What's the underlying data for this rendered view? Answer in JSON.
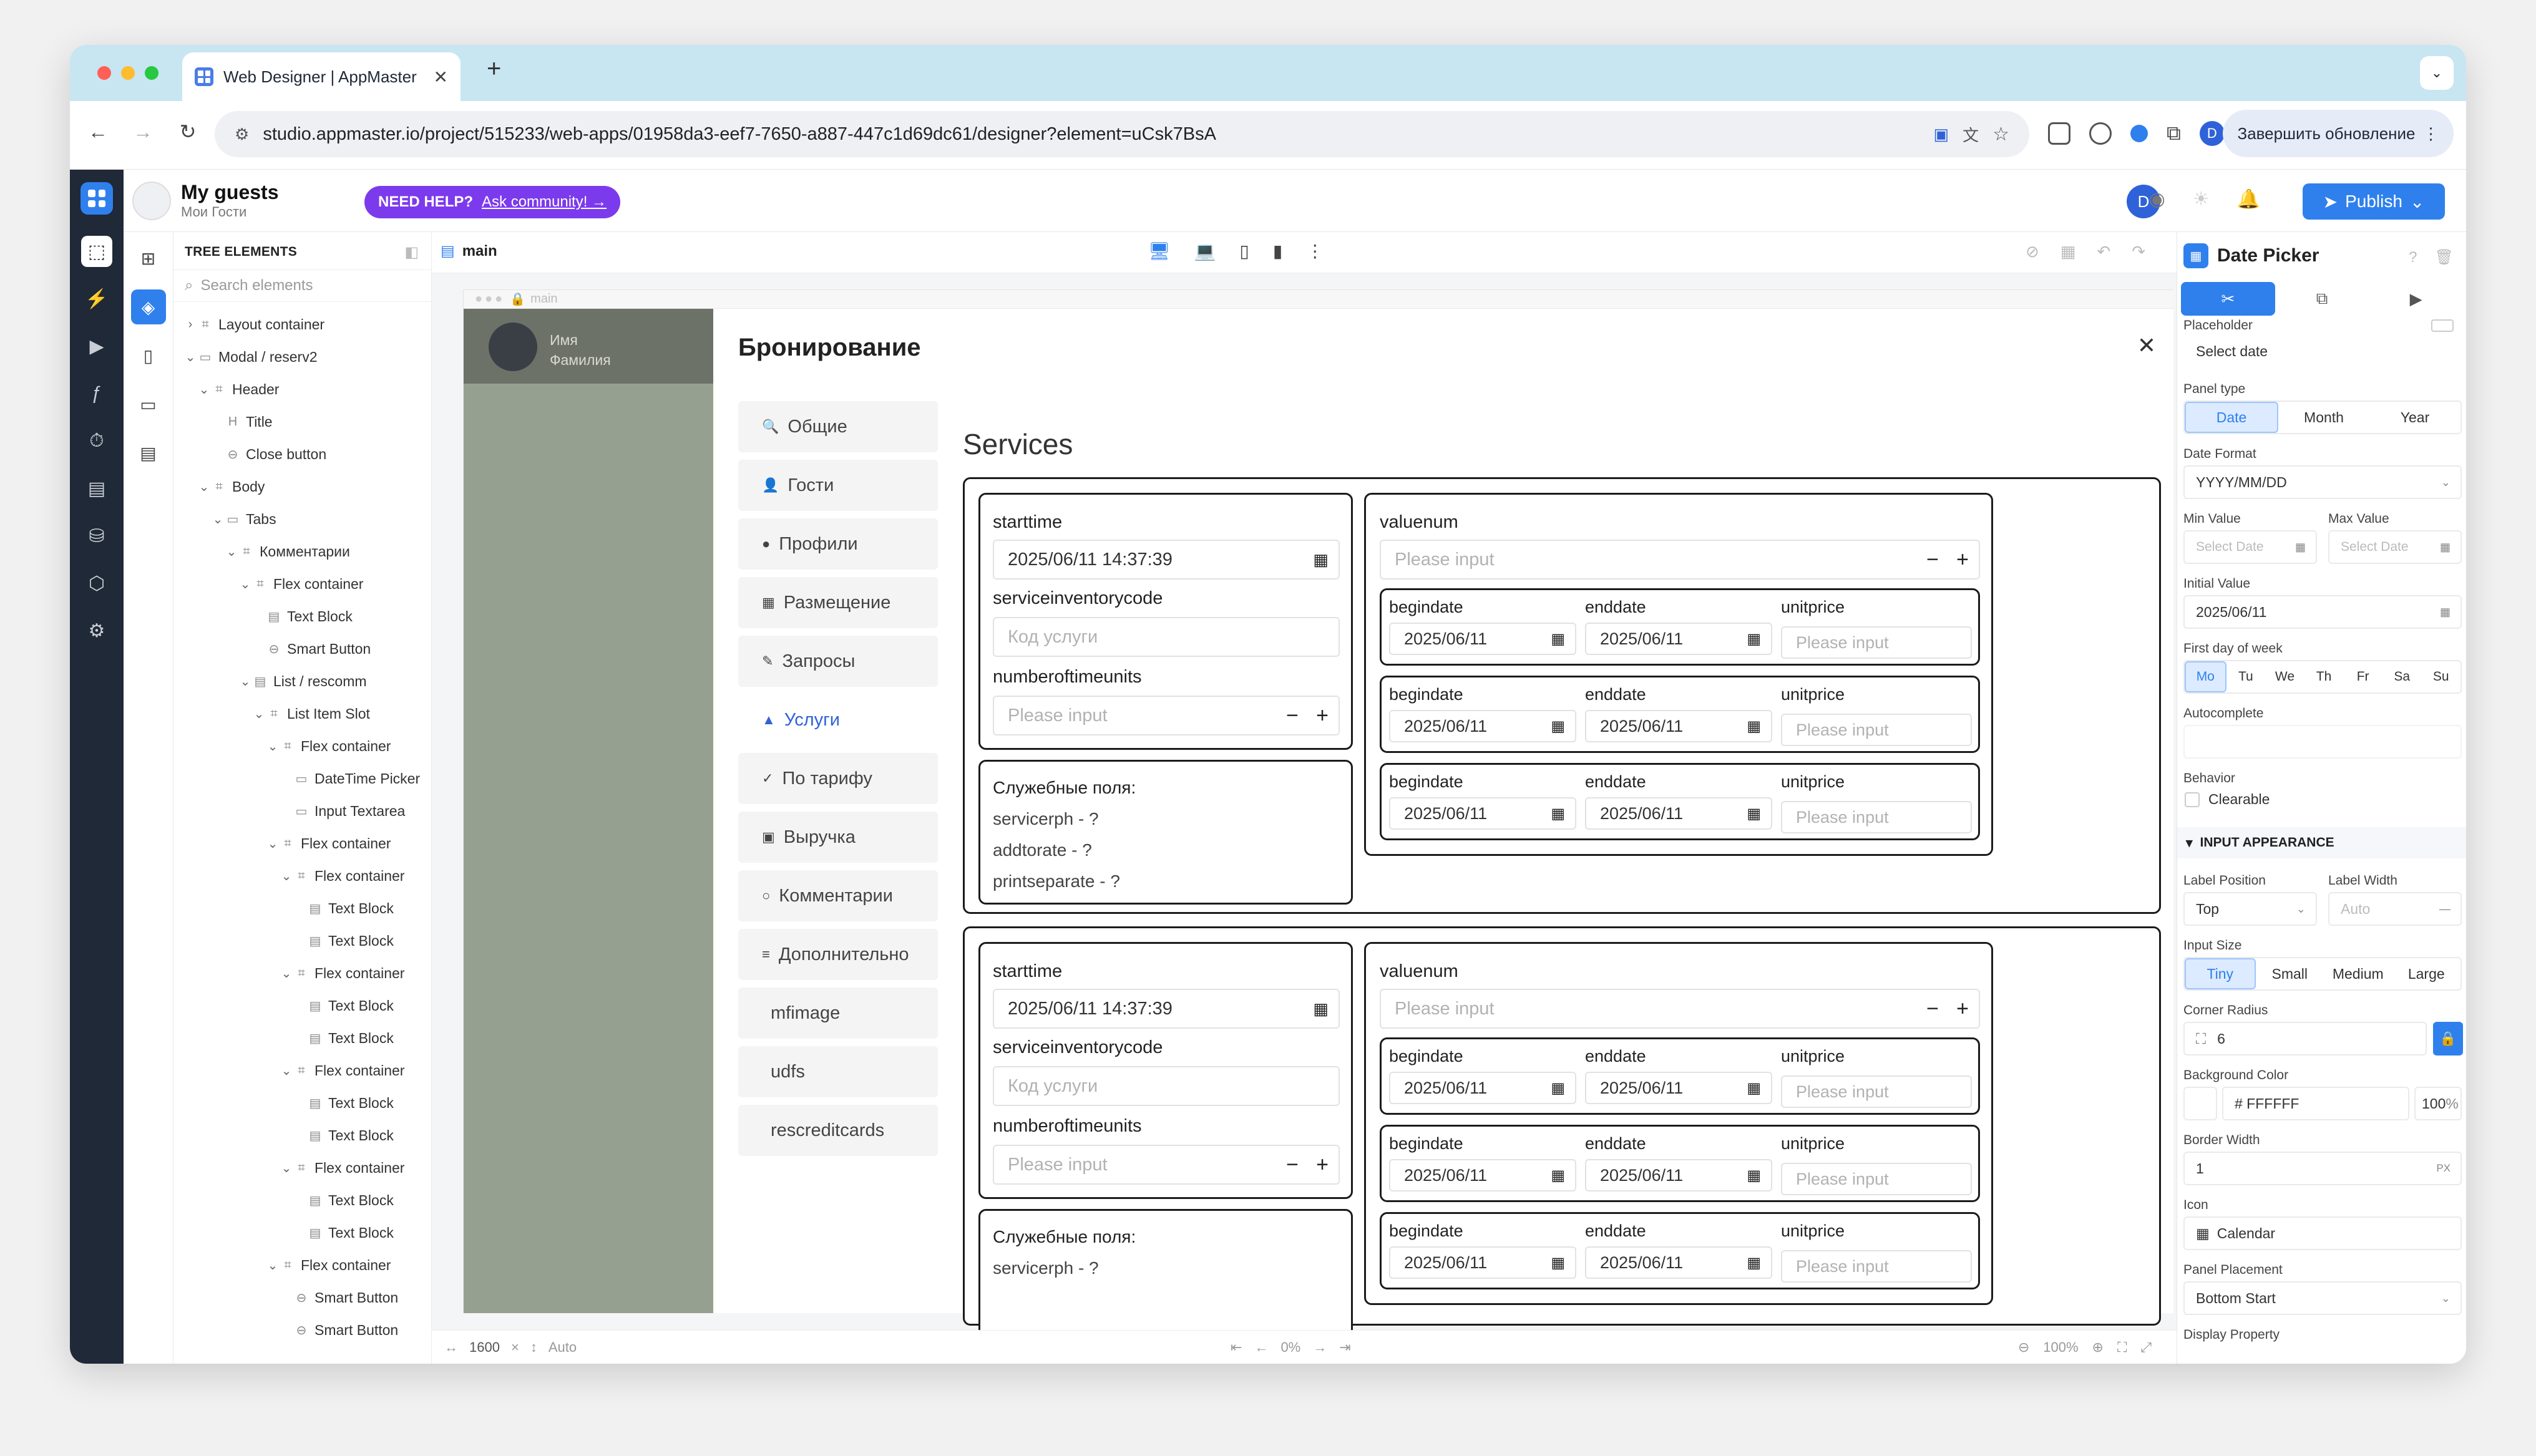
{
  "browser": {
    "tab_title": "Web Designer | AppMaster",
    "url": "studio.appmaster.io/project/515233/web-apps/01958da3-eef7-7650-a887-447c1d69dc61/designer?element=uCsk7BsA",
    "profile_initial": "D",
    "update_button": "Завершить обновление"
  },
  "project": {
    "name": "My guests",
    "subtitle": "Мои Гости",
    "help_label": "NEED HELP?",
    "help_link": "Ask community! →",
    "user_initial": "D",
    "publish": "Publish"
  },
  "tree": {
    "title": "TREE ELEMENTS",
    "search_placeholder": "Search elements",
    "page_name": "main",
    "items": [
      {
        "label": "Layout container",
        "depth": 0,
        "chev": "›",
        "icon": "⌗"
      },
      {
        "label": "Modal / reserv2",
        "depth": 0,
        "chev": "⌄",
        "icon": "▭"
      },
      {
        "label": "Header",
        "depth": 1,
        "chev": "⌄",
        "icon": "⌗"
      },
      {
        "label": "Title",
        "depth": 2,
        "chev": "",
        "icon": "H"
      },
      {
        "label": "Close button",
        "depth": 2,
        "chev": "",
        "icon": "⊖"
      },
      {
        "label": "Body",
        "depth": 1,
        "chev": "⌄",
        "icon": "⌗"
      },
      {
        "label": "Tabs",
        "depth": 2,
        "chev": "⌄",
        "icon": "▭"
      },
      {
        "label": "Комментарии",
        "depth": 3,
        "chev": "⌄",
        "icon": "⌗"
      },
      {
        "label": "Flex container",
        "depth": 4,
        "chev": "⌄",
        "icon": "⌗"
      },
      {
        "label": "Text Block",
        "depth": 5,
        "chev": "",
        "icon": "▤"
      },
      {
        "label": "Smart Button",
        "depth": 5,
        "chev": "",
        "icon": "⊖"
      },
      {
        "label": "List / rescomm",
        "depth": 4,
        "chev": "⌄",
        "icon": "▤"
      },
      {
        "label": "List Item Slot",
        "depth": 5,
        "chev": "⌄",
        "icon": "⌗"
      },
      {
        "label": "Flex container",
        "depth": 6,
        "chev": "⌄",
        "icon": "⌗"
      },
      {
        "label": "DateTime Picker",
        "depth": 7,
        "chev": "",
        "icon": "▭"
      },
      {
        "label": "Input Textarea",
        "depth": 7,
        "chev": "",
        "icon": "▭"
      },
      {
        "label": "Flex container",
        "depth": 6,
        "chev": "⌄",
        "icon": "⌗"
      },
      {
        "label": "Flex container",
        "depth": 7,
        "chev": "⌄",
        "icon": "⌗"
      },
      {
        "label": "Text Block",
        "depth": 8,
        "chev": "",
        "icon": "▤"
      },
      {
        "label": "Text Block",
        "depth": 8,
        "chev": "",
        "icon": "▤"
      },
      {
        "label": "Flex container",
        "depth": 7,
        "chev": "⌄",
        "icon": "⌗"
      },
      {
        "label": "Text Block",
        "depth": 8,
        "chev": "",
        "icon": "▤"
      },
      {
        "label": "Text Block",
        "depth": 8,
        "chev": "",
        "icon": "▤"
      },
      {
        "label": "Flex container",
        "depth": 7,
        "chev": "⌄",
        "icon": "⌗"
      },
      {
        "label": "Text Block",
        "depth": 8,
        "chev": "",
        "icon": "▤"
      },
      {
        "label": "Text Block",
        "depth": 8,
        "chev": "",
        "icon": "▤"
      },
      {
        "label": "Flex container",
        "depth": 7,
        "chev": "⌄",
        "icon": "⌗"
      },
      {
        "label": "Text Block",
        "depth": 8,
        "chev": "",
        "icon": "▤"
      },
      {
        "label": "Text Block",
        "depth": 8,
        "chev": "",
        "icon": "▤"
      },
      {
        "label": "Flex container",
        "depth": 6,
        "chev": "⌄",
        "icon": "⌗"
      },
      {
        "label": "Smart Button",
        "depth": 7,
        "chev": "",
        "icon": "⊖"
      },
      {
        "label": "Smart Button",
        "depth": 7,
        "chev": "",
        "icon": "⊖"
      }
    ]
  },
  "canvas": {
    "frame_label": "main",
    "user_name": "Имя",
    "user_surname": "Фамилия",
    "modal_title": "Бронирование",
    "tabs": [
      {
        "label": "Общие",
        "icon": "🔍",
        "active": false
      },
      {
        "label": "Гости",
        "icon": "👤",
        "active": false
      },
      {
        "label": "Профили",
        "icon": "●",
        "active": false
      },
      {
        "label": "Размещение",
        "icon": "▦",
        "active": false
      },
      {
        "label": "Запросы",
        "icon": "✎",
        "active": false
      },
      {
        "label": "Услуги",
        "icon": "▲",
        "active": true
      },
      {
        "label": "По тарифу",
        "icon": "✓",
        "active": false
      },
      {
        "label": "Выручка",
        "icon": "▣",
        "active": false
      },
      {
        "label": "Комментарии",
        "icon": "○",
        "active": false
      },
      {
        "label": "Дополнительно",
        "icon": "≡",
        "active": false
      },
      {
        "label": "mfimage",
        "icon": "",
        "active": false
      },
      {
        "label": "udfs",
        "icon": "",
        "active": false
      },
      {
        "label": "rescreditcards",
        "icon": "",
        "active": false
      }
    ],
    "services_title": "Services",
    "starttime_label": "starttime",
    "starttime_value": "2025/06/11 14:37:39",
    "serviceinventorycode_label": "serviceinventorycode",
    "serviceinventorycode_placeholder": "Код услуги",
    "numberoftimeunits_label": "numberoftimeunits",
    "please_input": "Please input",
    "system_fields_title": "Служебные поля:",
    "system_fields": [
      "servicerph - ?",
      "addtorate - ?",
      "printseparate - ?"
    ],
    "valuenum_label": "valuenum",
    "begindate_label": "begindate",
    "enddate_label": "enddate",
    "unitprice_label": "unitprice",
    "date_value": "2025/06/11",
    "selected_tag": "Date Picker",
    "footer": {
      "width": "1600",
      "height": "Auto",
      "scroll": "0%",
      "zoom": "100%"
    }
  },
  "props": {
    "title": "Date Picker",
    "placeholder_label": "Placeholder",
    "placeholder_value": "Select date",
    "panel_type_label": "Panel type",
    "panel_types": [
      "Date",
      "Month",
      "Year"
    ],
    "date_format_label": "Date Format",
    "date_format_value": "YYYY/MM/DD",
    "min_value_label": "Min Value",
    "max_value_label": "Max Value",
    "min_placeholder": "Select Date",
    "max_placeholder": "Select Date",
    "initial_value_label": "Initial Value",
    "initial_value": "2025/06/11",
    "first_day_label": "First day of week",
    "weekdays": [
      "Mo",
      "Tu",
      "We",
      "Th",
      "Fr",
      "Sa",
      "Su"
    ],
    "autocomplete_label": "Autocomplete",
    "behavior_label": "Behavior",
    "clearable_label": "Clearable",
    "input_appearance": "INPUT APPEARANCE",
    "label_position_label": "Label Position",
    "label_position_value": "Top",
    "label_width_label": "Label Width",
    "label_width_value": "Auto",
    "input_size_label": "Input Size",
    "input_sizes": [
      "Tiny",
      "Small",
      "Medium",
      "Large"
    ],
    "corner_radius_label": "Corner Radius",
    "corner_radius_value": "6",
    "background_color_label": "Background Color",
    "background_color_value": "# FFFFFF",
    "background_opacity": "100",
    "border_width_label": "Border Width",
    "border_width_value": "1",
    "icon_label": "Icon",
    "icon_value": "Calendar",
    "panel_placement_label": "Panel Placement",
    "panel_placement_value": "Bottom Start",
    "display_property_label": "Display Property"
  },
  "colors": {
    "accent": "#2f80ed",
    "help": "#7c3aed",
    "rail": "#1f2937",
    "overlay": "#96a090"
  }
}
